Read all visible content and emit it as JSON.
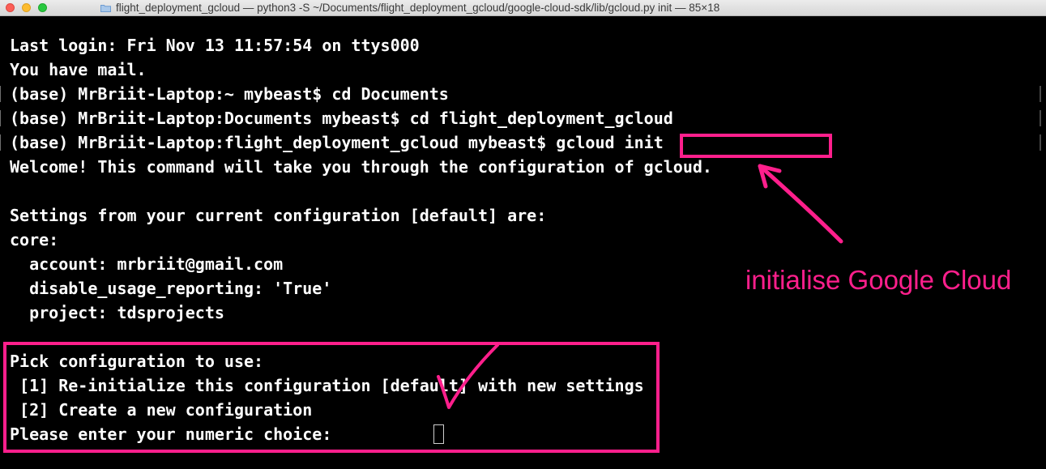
{
  "window": {
    "title": "flight_deployment_gcloud — python3 -S ~/Documents/flight_deployment_gcloud/google-cloud-sdk/lib/gcloud.py init — 85×18"
  },
  "terminal": {
    "lines": [
      "Last login: Fri Nov 13 11:57:54 on ttys000",
      "You have mail.",
      "(base) MrBriit-Laptop:~ mybeast$ cd Documents",
      "(base) MrBriit-Laptop:Documents mybeast$ cd flight_deployment_gcloud",
      "(base) MrBriit-Laptop:flight_deployment_gcloud mybeast$ gcloud init",
      "Welcome! This command will take you through the configuration of gcloud.",
      "",
      "Settings from your current configuration [default] are:",
      "core:",
      "  account: mrbriit@gmail.com",
      "  disable_usage_reporting: 'True'",
      "  project: tdsprojects",
      "",
      "Pick configuration to use:",
      " [1] Re-initialize this configuration [default] with new settings",
      " [2] Create a new configuration",
      "Please enter your numeric choice:  "
    ]
  },
  "annotation": {
    "label": "initialise Google Cloud",
    "color": "#ff1f8c"
  },
  "icons": {
    "folder": "folder-icon",
    "check": "checkmark-icon",
    "arrow": "arrow-icon"
  }
}
